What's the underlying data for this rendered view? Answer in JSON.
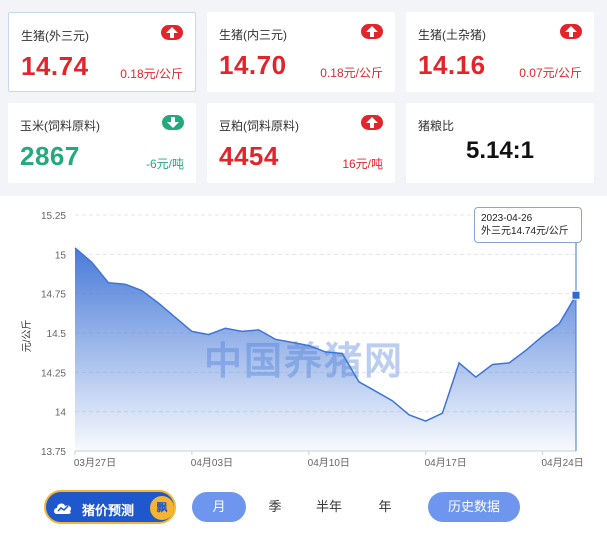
{
  "cards": [
    {
      "title": "生猪(外三元)",
      "price": "14.74",
      "change": "0.18元/公斤",
      "direction": "up",
      "selected": true
    },
    {
      "title": "生猪(内三元)",
      "price": "14.70",
      "change": "0.18元/公斤",
      "direction": "up"
    },
    {
      "title": "生猪(土杂猪)",
      "price": "14.16",
      "change": "0.07元/公斤",
      "direction": "up"
    },
    {
      "title": "玉米(饲料原料)",
      "price": "2867",
      "change": "-6元/吨",
      "direction": "down"
    },
    {
      "title": "豆粕(饲料原料)",
      "price": "4454",
      "change": "16元/吨",
      "direction": "up"
    },
    {
      "title": "猪粮比",
      "value": "5.14:1"
    }
  ],
  "chart_data": {
    "type": "area",
    "ylabel": "元/公斤",
    "ylim": [
      13.75,
      15.25
    ],
    "yticks": [
      "15.25",
      "15",
      "14.75",
      "14.5",
      "14.25",
      "14",
      "13.75"
    ],
    "x_tick_labels": [
      "03月27日",
      "04月03日",
      "04月10日",
      "04月17日",
      "04月24日"
    ],
    "x": [
      "2023-03-27",
      "2023-03-28",
      "2023-03-29",
      "2023-03-30",
      "2023-03-31",
      "2023-04-01",
      "2023-04-02",
      "2023-04-03",
      "2023-04-04",
      "2023-04-05",
      "2023-04-06",
      "2023-04-07",
      "2023-04-08",
      "2023-04-09",
      "2023-04-10",
      "2023-04-11",
      "2023-04-12",
      "2023-04-13",
      "2023-04-14",
      "2023-04-15",
      "2023-04-16",
      "2023-04-17",
      "2023-04-18",
      "2023-04-19",
      "2023-04-20",
      "2023-04-21",
      "2023-04-22",
      "2023-04-23",
      "2023-04-24",
      "2023-04-25",
      "2023-04-26"
    ],
    "series": [
      {
        "values": [
          15.04,
          14.95,
          14.82,
          14.81,
          14.77,
          14.69,
          14.6,
          14.51,
          14.49,
          14.53,
          14.51,
          14.52,
          14.46,
          14.44,
          14.42,
          14.38,
          14.37,
          14.19,
          14.13,
          14.07,
          13.98,
          13.94,
          13.99,
          14.31,
          14.22,
          14.3,
          14.31,
          14.39,
          14.48,
          14.56,
          14.74
        ]
      }
    ],
    "grid": true,
    "watermark": "中国养猪网",
    "tooltip": {
      "date": "2023-04-26",
      "text": "外三元14.74元/公斤"
    }
  },
  "controls": {
    "forecast_label": "猪价预测",
    "forecast_badge": "飘",
    "periods": [
      "月",
      "季",
      "半年",
      "年"
    ],
    "active_period": "月",
    "history_label": "历史数据"
  },
  "colors": {
    "up": "#e3242b",
    "down": "#23a97e",
    "line": "#3f74d6",
    "accent": "#6f96ee"
  }
}
